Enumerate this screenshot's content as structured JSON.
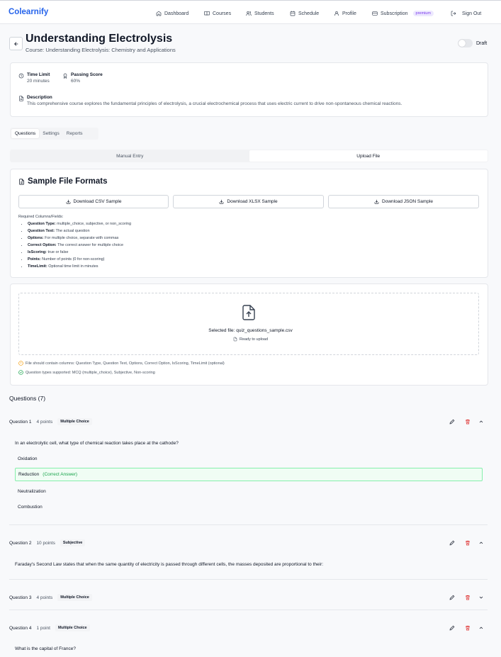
{
  "nav": {
    "brand": "Colearnify",
    "links": [
      {
        "label": "Dashboard",
        "icon": "home-icon"
      },
      {
        "label": "Courses",
        "icon": "book-icon"
      },
      {
        "label": "Students",
        "icon": "users-icon"
      },
      {
        "label": "Schedule",
        "icon": "calendar-icon"
      },
      {
        "label": "Profile",
        "icon": "user-icon"
      },
      {
        "label": "Subscription",
        "icon": "credit-card-icon",
        "badge": "premium"
      },
      {
        "label": "Sign Out",
        "icon": "logout-icon"
      }
    ]
  },
  "header": {
    "title": "Understanding Electrolysis",
    "subtitle": "Course: Understanding Electrolysis: Chemistry and Applications",
    "draft_label": "Draft"
  },
  "info": {
    "time_limit_label": "Time Limit",
    "time_limit_value": "20 minutes",
    "passing_label": "Passing Score",
    "passing_value": "60%",
    "description_label": "Description",
    "description_value": "This comprehensive course explores the fundamental principles of electrolysis, a crucial electrochemical process that uses electric current to drive non-spontaneous chemical reactions."
  },
  "tabs": [
    "Questions",
    "Settings",
    "Reports"
  ],
  "entry_modes": [
    "Manual Entry",
    "Upload File"
  ],
  "samples": {
    "title": "Sample File Formats",
    "buttons": [
      "Download CSV Sample",
      "Download XLSX Sample",
      "Download JSON Sample"
    ],
    "required_title": "Required Columns/Fields:",
    "fields": [
      {
        "name": "Question Type:",
        "desc": "multiple_choice, subjective, or non_scoring"
      },
      {
        "name": "Question Text:",
        "desc": "The actual question"
      },
      {
        "name": "Options:",
        "desc": "For multiple choice, separate with commas"
      },
      {
        "name": "Correct Option:",
        "desc": "The correct answer for multiple choice"
      },
      {
        "name": "IsScoring:",
        "desc": "true or false"
      },
      {
        "name": "Points:",
        "desc": "Number of points (0 for non-scoring)"
      },
      {
        "name": "TimeLimit:",
        "desc": "Optional time limit in minutes"
      }
    ]
  },
  "upload": {
    "selected_text": "Selected file: quiz_questions_sample.csv",
    "ready_text": "Ready to upload",
    "note_columns": "File should contain columns: Question Type, Question Text, Options, Correct Option, IsScoring, TimeLimit (optional)",
    "note_types": "Question types supported: MCQ (multiple_choice), Subjective, Non-scoring",
    "warn_color": "#f59e0b",
    "ok_color": "#16a34a"
  },
  "questions_heading": "Questions (7)",
  "questions": [
    {
      "num": "Question 1",
      "points": "4 points",
      "type": "Multiple Choice",
      "text": "In an electrolytic cell, what type of chemical reaction takes place at the cathode?",
      "options": [
        "Oxidation",
        "Reduction",
        "Neutralization",
        "Combustion"
      ],
      "correct_suffix": "(Correct Answer)"
    },
    {
      "num": "Question 2",
      "points": "10 points",
      "type": "Subjective",
      "text": "Faraday's Second Law states that when the same quantity of electricity is passed through different cells, the masses deposited are proportional to their:"
    },
    {
      "num": "Question 3",
      "points": "4 points",
      "type": "Multiple Choice"
    },
    {
      "num": "Question 4",
      "points": "1 point",
      "type": "Multiple Choice",
      "text": "What is the capital of France?"
    }
  ],
  "colors": {
    "brand": "#2563eb",
    "danger": "#dc2626",
    "success": "#16a34a"
  }
}
